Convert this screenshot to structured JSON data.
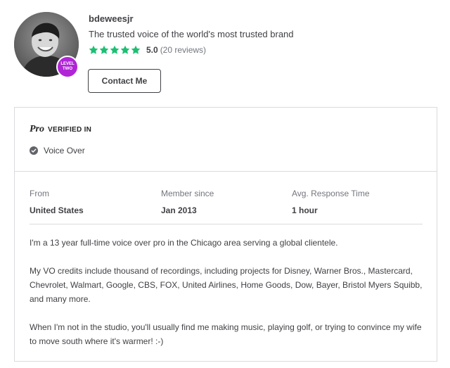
{
  "seller": {
    "username": "bdeweesjr",
    "tagline": "The trusted voice of the world's most trusted brand",
    "level_badge": [
      "LEVEL",
      "TWO"
    ],
    "rating_score": "5.0",
    "rating_count": "(20 reviews)",
    "stars": 5,
    "contact_label": "Contact Me"
  },
  "pro": {
    "logo_text": "Pro",
    "verified_label": "VERIFIED IN",
    "skills": [
      "Voice Over"
    ]
  },
  "stats": {
    "from_label": "From",
    "from_value": "United States",
    "member_label": "Member since",
    "member_value": "Jan 2013",
    "response_label": "Avg. Response Time",
    "response_value": "1 hour"
  },
  "about": [
    "I'm a 13 year full-time voice over pro in the Chicago area serving a global clientele.",
    "My VO credits include thousand of recordings, including projects for Disney, Warner Bros., Mastercard, Chevrolet, Walmart, Google, CBS, FOX, United Airlines, Home Goods, Dow, Bayer, Bristol Myers Squibb, and many more.",
    "When I'm not in the studio, you'll usually find me making music, playing golf, or trying to convince my wife to move south where it's warmer! :-)"
  ],
  "colors": {
    "star": "#1dbf73",
    "badge": "#b025d6",
    "text": "#404145",
    "muted": "#74767e",
    "border": "#dadbdd"
  },
  "icons": {
    "star": "star-icon",
    "check": "check-circle-icon"
  }
}
